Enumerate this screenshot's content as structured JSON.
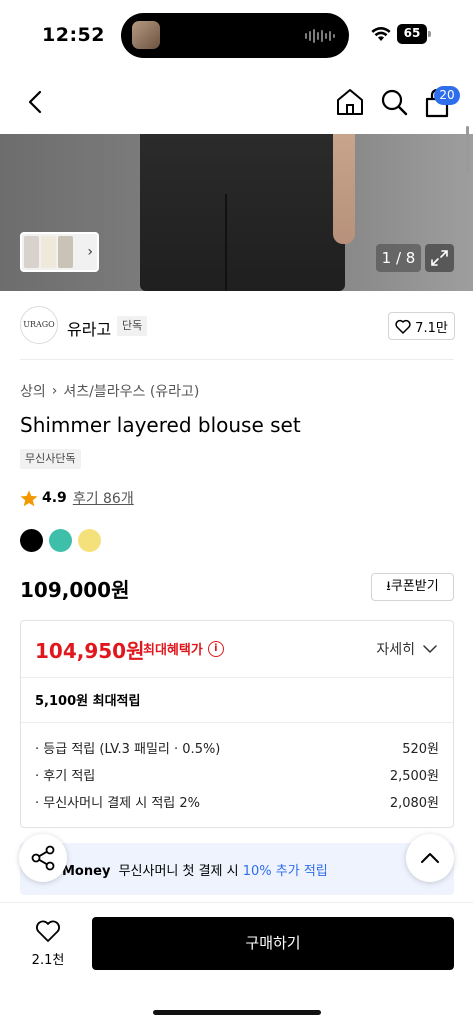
{
  "status": {
    "time": "12:52",
    "battery": "65"
  },
  "nav": {
    "cart_count": "20"
  },
  "gallery": {
    "counter": "1 / 8"
  },
  "brand": {
    "logo_text": "URAGO",
    "name": "유라고",
    "tag": "단독",
    "likes": "7.1만"
  },
  "breadcrumb": {
    "level1": "상의",
    "level2": "셔츠/블라우스 (유라고)"
  },
  "product": {
    "title": "Shimmer layered blouse set",
    "exclusive_tag": "무신사단독",
    "rating": "4.9",
    "reviews": "후기 86개",
    "colors": [
      "#000000",
      "#3dbfa9",
      "#f5e17c"
    ],
    "price": "109,000원",
    "coupon_label": "쿠폰받기"
  },
  "benefit": {
    "sale_price": "104,950원",
    "sale_label": "최대혜택가",
    "detail_label": "자세히",
    "max_point": "5,100원 최대적립",
    "rows": [
      {
        "label": "· 등급 적립 (LV.3 패밀리 · 0.5%)",
        "value": "520원"
      },
      {
        "label": "· 후기 적립",
        "value": "2,500원"
      },
      {
        "label": "· 무신사머니 결제 시 적립 2%",
        "value": "2,080원"
      }
    ]
  },
  "money_banner": {
    "brand": "Money",
    "text": "무신사머니 첫 결제 시",
    "highlight": "10% 추가 적립"
  },
  "bottom": {
    "wish_count": "2.1천",
    "buy_label": "구매하기"
  },
  "colors": {
    "sale_red": "#e0181e",
    "accent_blue": "#2f6eea",
    "banner_bg": "#eef3fe"
  }
}
